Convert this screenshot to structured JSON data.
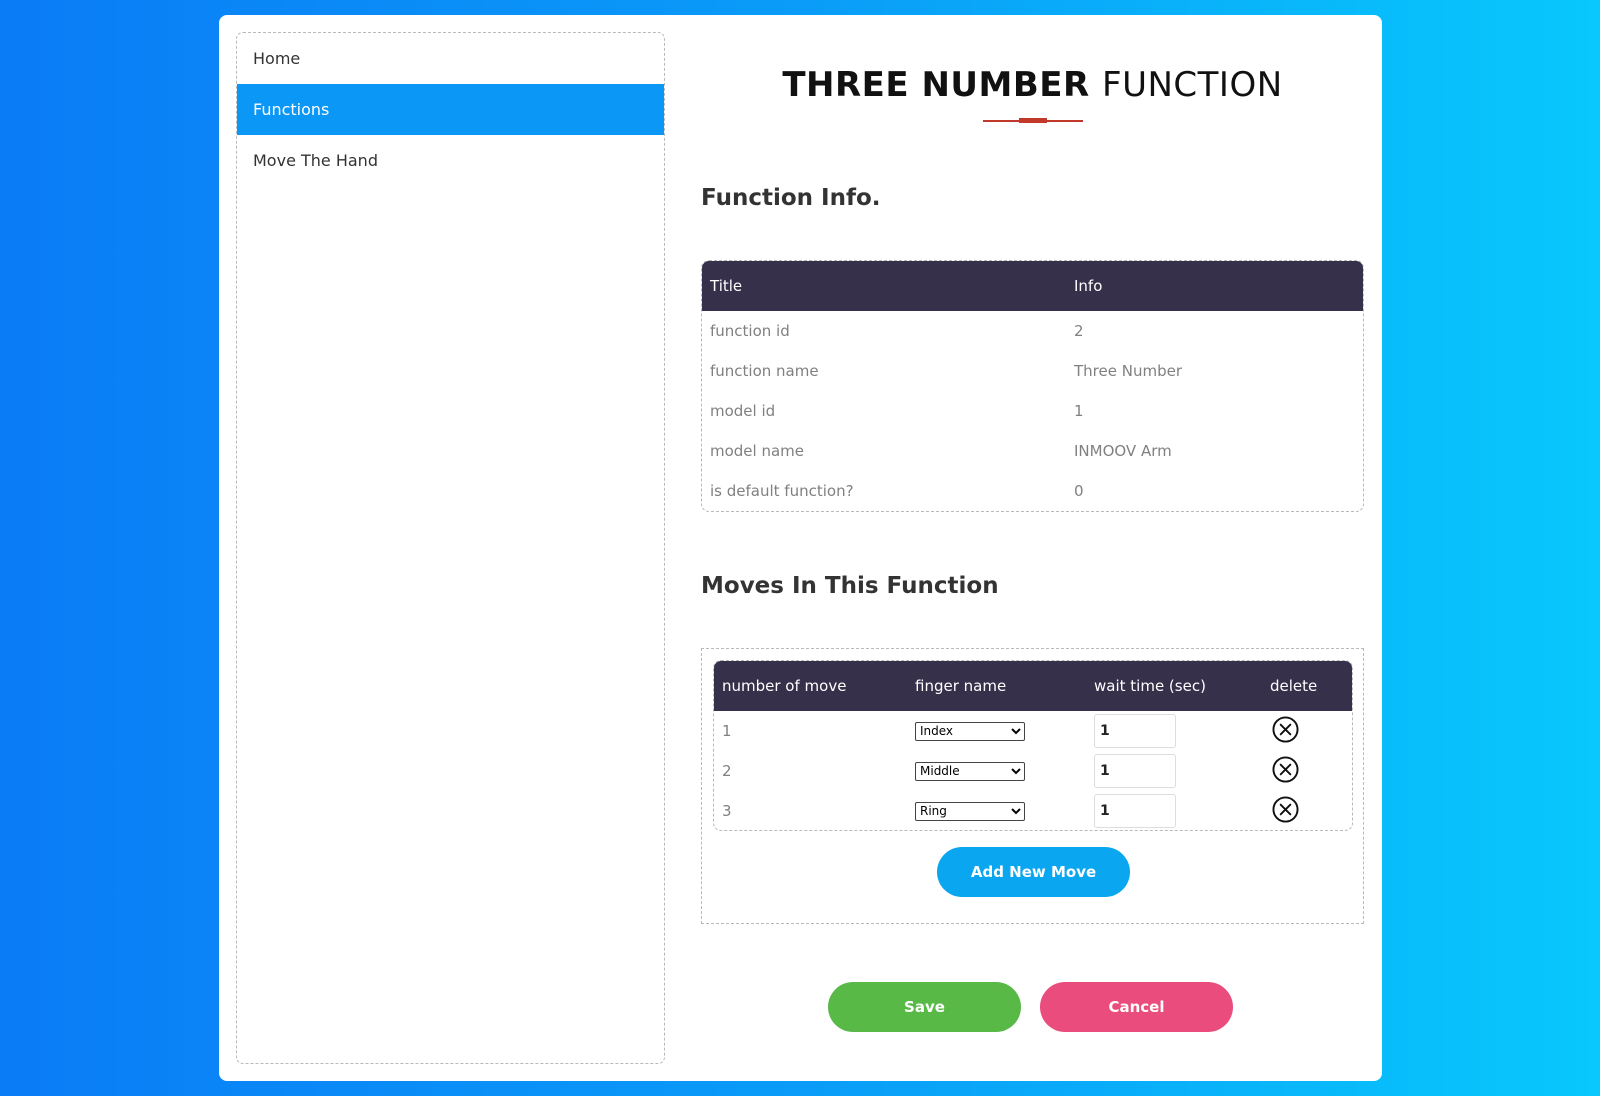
{
  "sidebar": {
    "items": [
      {
        "label": "Home"
      },
      {
        "label": "Functions"
      },
      {
        "label": "Move The Hand"
      }
    ]
  },
  "page": {
    "title_bold": "THREE NUMBER",
    "title_light": "FUNCTION"
  },
  "function_info": {
    "heading": "Function Info.",
    "headers": {
      "title": "Title",
      "info": "Info"
    },
    "rows": [
      {
        "title": "function id",
        "info": "2"
      },
      {
        "title": "function name",
        "info": "Three Number"
      },
      {
        "title": "model id",
        "info": "1"
      },
      {
        "title": "model name",
        "info": "INMOOV Arm"
      },
      {
        "title": "is default function?",
        "info": "0"
      }
    ]
  },
  "moves": {
    "heading": "Moves In This Function",
    "headers": {
      "number": "number of move",
      "finger": "finger name",
      "wait": "wait time (sec)",
      "delete": "delete"
    },
    "rows": [
      {
        "number": "1",
        "finger": "Index",
        "wait": "1"
      },
      {
        "number": "2",
        "finger": "Middle",
        "wait": "1"
      },
      {
        "number": "3",
        "finger": "Ring",
        "wait": "1"
      }
    ],
    "add_label": "Add New Move"
  },
  "actions": {
    "save_label": "Save",
    "cancel_label": "Cancel"
  },
  "colors": {
    "active_nav": "#0a97f5",
    "table_header": "#36304a",
    "add_button": "#0aa6ef",
    "save_button": "#58b947",
    "cancel_button": "#ea4c7d",
    "accent_rule": "#c0392b"
  }
}
